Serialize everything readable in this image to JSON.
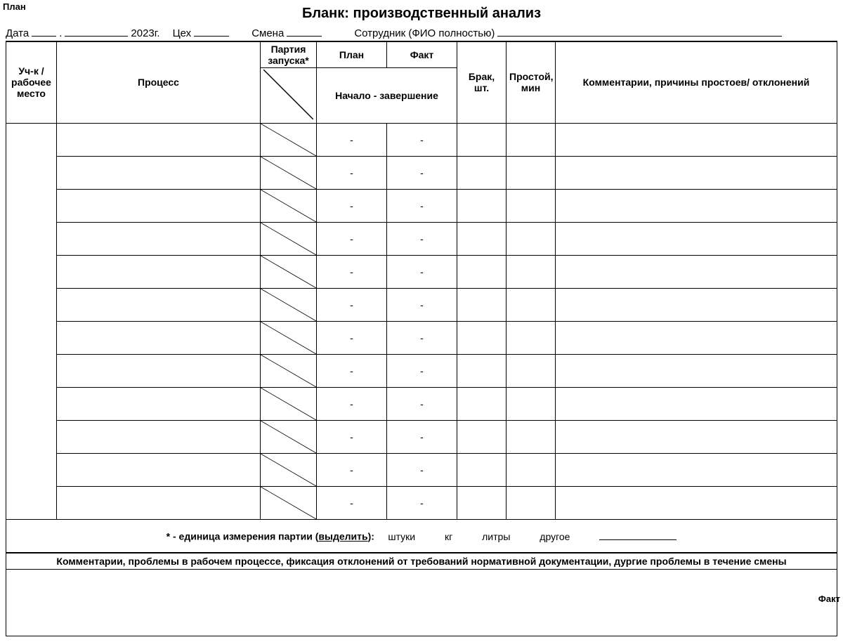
{
  "title": "Бланк: производственный анализ",
  "meta": {
    "date_label": "Дата",
    "year": "2023г.",
    "shop_label": "Цех",
    "shift_label": "Смена",
    "employee_label": "Сотрудник (ФИО полностью)"
  },
  "headers": {
    "workplace": "Уч-к / рабочее место",
    "process": "Процесс",
    "batch": "Партия запуска*",
    "plan": "План",
    "fact": "Факт",
    "defect": "Брак, шт.",
    "downtime": "Простой, мин",
    "comment": "Комментарии, причины простоев/ отклонений",
    "start_end": "Начало - завершение",
    "diag_plan": "План",
    "diag_fact": "Факт"
  },
  "rows": [
    {
      "plan": "-",
      "fact": "-"
    },
    {
      "plan": "-",
      "fact": "-"
    },
    {
      "plan": "-",
      "fact": "-"
    },
    {
      "plan": "-",
      "fact": "-"
    },
    {
      "plan": "-",
      "fact": "-"
    },
    {
      "plan": "-",
      "fact": "-"
    },
    {
      "plan": "-",
      "fact": "-"
    },
    {
      "plan": "-",
      "fact": "-"
    },
    {
      "plan": "-",
      "fact": "-"
    },
    {
      "plan": "-",
      "fact": "-"
    },
    {
      "plan": "-",
      "fact": "-"
    },
    {
      "plan": "-",
      "fact": "-"
    }
  ],
  "unit_note": {
    "prefix": "* - единица измерения партии (",
    "underlined": "выделить",
    "suffix": "):",
    "options": [
      "штуки",
      "кг",
      "литры",
      "другое"
    ]
  },
  "comments_header": "Комментарии, проблемы в рабочем процессе, фиксация отклонений от требований нормативной документации, дургие проблемы в течение смены"
}
